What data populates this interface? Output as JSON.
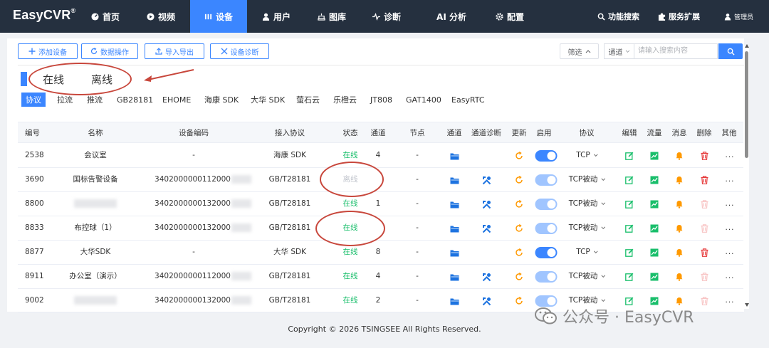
{
  "app": {
    "logo": "EasyCVR",
    "logo_mark": "®"
  },
  "nav": [
    {
      "label": "首页",
      "icon": "speedometer-icon"
    },
    {
      "label": "视频",
      "icon": "play-icon"
    },
    {
      "label": "设备",
      "icon": "device-icon",
      "active": true
    },
    {
      "label": "用户",
      "icon": "user-icon"
    },
    {
      "label": "图库",
      "icon": "gallery-icon"
    },
    {
      "label": "诊断",
      "icon": "pulse-icon"
    },
    {
      "label": "AI 分析",
      "icon": ""
    },
    {
      "label": "配置",
      "icon": "gear-icon"
    }
  ],
  "right_nav": {
    "search": "功能搜索",
    "extensions": "服务扩展",
    "admin": "管理员"
  },
  "toolbar": {
    "add": "添加设备",
    "data_ops": "数据操作",
    "import_export": "导入导出",
    "diagnose": "设备诊断"
  },
  "filter": {
    "label": "筛选",
    "select": "通道",
    "placeholder": "请输入搜索内容"
  },
  "status_tabs": {
    "online": "在线",
    "offline": "离线"
  },
  "protocol_tabs": [
    "协议",
    "拉流",
    "推流",
    "GB28181",
    "EHOME",
    "海康 SDK",
    "大华 SDK",
    "萤石云",
    "乐橙云",
    "JT808",
    "GAT1400",
    "EasyRTC"
  ],
  "columns": [
    "编号",
    "名称",
    "设备编码",
    "接入协议",
    "状态",
    "通道",
    "节点",
    "通道",
    "通道诊断",
    "更新",
    "启用",
    "协议",
    "编辑",
    "流量",
    "消息",
    "删除",
    "其他"
  ],
  "rows": [
    {
      "id": "2538",
      "name": "会议室",
      "code": "-",
      "proto": "海康 SDK",
      "status": "在线",
      "channels": "4",
      "node": "-",
      "diag": false,
      "enabled": "on",
      "transport": "TCP",
      "del": true
    },
    {
      "id": "3690",
      "name": "国标告警设备",
      "code": "3402000000112000",
      "proto": "GB/T28181",
      "status": "离线",
      "channels": "",
      "node": "-",
      "diag": true,
      "enabled": "dis",
      "transport": "TCP被动",
      "del": true
    },
    {
      "id": "8800",
      "name": "",
      "code": "3402000000132000",
      "proto": "GB/T28181",
      "status": "在线",
      "channels": "1",
      "node": "-",
      "diag": true,
      "enabled": "dis",
      "transport": "TCP被动",
      "del": false
    },
    {
      "id": "8833",
      "name": "布控球（1）",
      "code": "3402000000132000",
      "proto": "GB/T28181",
      "status": "在线",
      "channels": "",
      "node": "-",
      "diag": true,
      "enabled": "dis",
      "transport": "TCP被动",
      "del": false
    },
    {
      "id": "8877",
      "name": "大华SDK",
      "code": "-",
      "proto": "大华 SDK",
      "status": "在线",
      "channels": "8",
      "node": "-",
      "diag": false,
      "enabled": "on",
      "transport": "TCP",
      "del": true
    },
    {
      "id": "8911",
      "name": "办公室（演示）",
      "code": "3402000000112000",
      "proto": "GB/T28181",
      "status": "在线",
      "channels": "4",
      "node": "-",
      "diag": true,
      "enabled": "dis",
      "transport": "TCP被动",
      "del": false
    },
    {
      "id": "9002",
      "name": "",
      "code": "3402000000132000",
      "proto": "GB/T28181",
      "status": "在线",
      "channels": "2",
      "node": "-",
      "diag": true,
      "enabled": "dis",
      "transport": "TCP被动",
      "del": false
    }
  ],
  "footer": "Copyright © 2026 TSINGSEE All Rights Reserved.",
  "watermark": "公众号 · EasyCVR",
  "colors": {
    "topbar": "#25303f",
    "accent": "#3b86ff",
    "online": "#19be6b",
    "offline": "#c0c4cc",
    "annotation": "#c8473c",
    "edit": "#19be6b",
    "delete": "#e6393a",
    "message": "#ff9900",
    "refresh": "#ff9900"
  }
}
